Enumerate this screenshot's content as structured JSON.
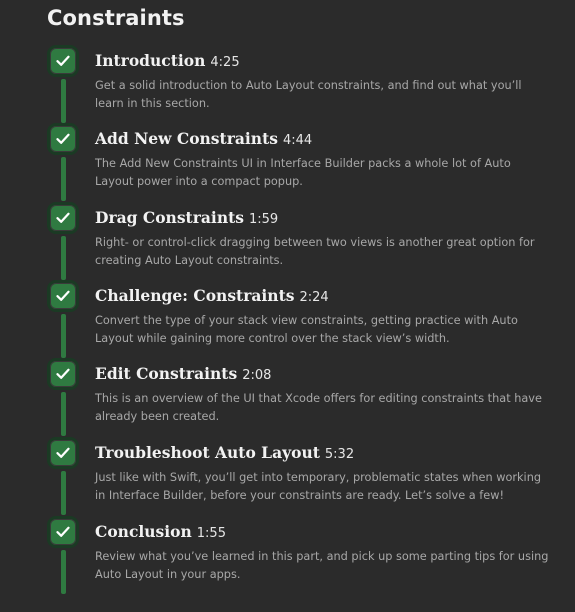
{
  "section": {
    "title": "Constraints"
  },
  "icons": {
    "complete": "checkmark-icon",
    "accent_color": "#2f7a41"
  },
  "lessons": [
    {
      "title": "Introduction",
      "duration": "4:25",
      "description": "Get a solid introduction to Auto Layout constraints, and find out what you’ll learn in this section.",
      "completed": true
    },
    {
      "title": "Add New Constraints",
      "duration": "4:44",
      "description": "The Add New Constraints UI in Interface Builder packs a whole lot of Auto Layout power into a compact popup.",
      "completed": true
    },
    {
      "title": "Drag Constraints",
      "duration": "1:59",
      "description": "Right- or control-click dragging between two views is another great option for creating Auto Layout constraints.",
      "completed": true
    },
    {
      "title": "Challenge: Constraints",
      "duration": "2:24",
      "description": "Convert the type of your stack view constraints, getting practice with Auto Layout while gaining more control over the stack view’s width.",
      "completed": true
    },
    {
      "title": "Edit Constraints",
      "duration": "2:08",
      "description": "This is an overview of the UI that Xcode offers for editing constraints that have already been created.",
      "completed": true
    },
    {
      "title": "Troubleshoot Auto Layout",
      "duration": "5:32",
      "description": "Just like with Swift, you’ll get into temporary, problematic states when working in Interface Builder, before your constraints are ready. Let’s solve a few!",
      "completed": true
    },
    {
      "title": "Conclusion",
      "duration": "1:55",
      "description": "Review what you’ve learned in this part, and pick up some parting tips for using Auto Layout in your apps.",
      "completed": true
    }
  ]
}
